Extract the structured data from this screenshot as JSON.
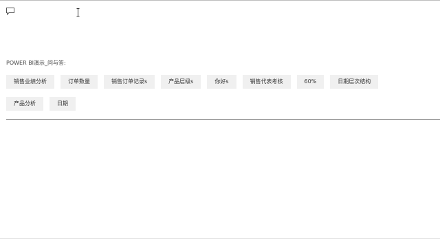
{
  "qa": {
    "input_value": "",
    "input_placeholder": ""
  },
  "section": {
    "label": "POWER BI演示_问与答:"
  },
  "suggestions": {
    "row1": [
      {
        "label": "销售业绩分析"
      },
      {
        "label": "订单数量"
      },
      {
        "label": "销售订单记录s"
      },
      {
        "label": "产品层级s"
      },
      {
        "label": "你好s"
      },
      {
        "label": "销售代表考核"
      },
      {
        "label": "60%"
      },
      {
        "label": "日期层次结构"
      }
    ],
    "row2": [
      {
        "label": "产品分析"
      },
      {
        "label": "日期"
      }
    ]
  },
  "icons": {
    "chat": "chat-bubble-icon",
    "cursor": "text-cursor-icon"
  },
  "colors": {
    "chip_background": "#f0f0f0",
    "divider": "#8a8a8a",
    "text": "#333333"
  }
}
